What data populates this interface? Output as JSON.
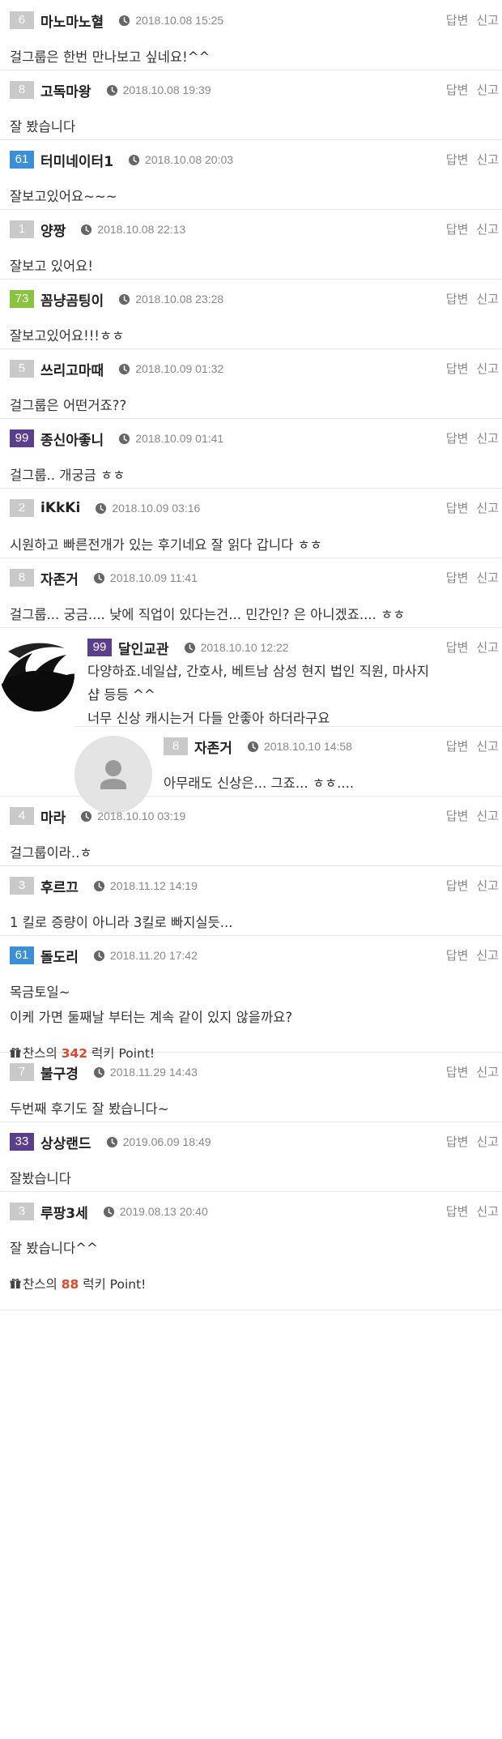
{
  "actions": {
    "reply": "답변",
    "report": "신고"
  },
  "comments": [
    {
      "level": "6",
      "level_color": "#c9c9c9",
      "nick": "마노마노혈",
      "time": "2018.10.08 15:25",
      "lines": [
        "걸그룹은 한번 만나보고 싶네요!^^"
      ]
    },
    {
      "level": "8",
      "level_color": "#c9c9c9",
      "nick": "고독마왕",
      "time": "2018.10.08 19:39",
      "lines": [
        "잘 봤습니다"
      ]
    },
    {
      "level": "61",
      "level_color": "#3a8fd6",
      "nick": "터미네이터1",
      "time": "2018.10.08 20:03",
      "lines": [
        "잘보고있어요~~~"
      ]
    },
    {
      "level": "1",
      "level_color": "#c9c9c9",
      "nick": "양짱",
      "time": "2018.10.08 22:13",
      "lines": [
        "잘보고 있어요!"
      ]
    },
    {
      "level": "73",
      "level_color": "#8ac43f",
      "nick": "꼼냥곰팅이",
      "time": "2018.10.08 23:28",
      "lines": [
        "잘보고있어요!!!ㅎㅎ"
      ]
    },
    {
      "level": "5",
      "level_color": "#c9c9c9",
      "nick": "쓰리고마때",
      "time": "2018.10.09 01:32",
      "lines": [
        "걸그룹은 어떤거죠??"
      ]
    },
    {
      "level": "99",
      "level_color": "#5b3f8c",
      "nick": "종신아좋니",
      "time": "2018.10.09 01:41",
      "lines": [
        "걸그룹.. 개궁금 ㅎㅎ"
      ]
    },
    {
      "level": "2",
      "level_color": "#c9c9c9",
      "nick": "iKkKi",
      "time": "2018.10.09 03:16",
      "lines": [
        "시원하고 빠른전개가 있는 후기네요 잘 읽다 갑니다 ㅎㅎ"
      ]
    },
    {
      "level": "8",
      "level_color": "#c9c9c9",
      "nick": "자존거",
      "time": "2018.10.09 11:41",
      "lines": [
        "걸그룹... 궁금....   낮에 직업이 있다는건...   민간인? 은 아니겠죠....   ㅎㅎ"
      ]
    },
    {
      "level": "99",
      "level_color": "#5b3f8c",
      "nick": "달인교관",
      "time": "2018.10.10 12:22",
      "lines": [
        "다양하죠.네일샵, 간호사, 베트남 삼성 현지 법인 직원, 마사지",
        "샵 등등 ^^",
        "너무 신상 캐시는거 다들 안좋아 하더라구요"
      ]
    },
    {
      "level": "8",
      "level_color": "#c9c9c9",
      "nick": "자존거",
      "time": "2018.10.10 14:58",
      "lines": [
        "아무래도 신상은...   그죠...   ㅎㅎ...."
      ]
    },
    {
      "level": "4",
      "level_color": "#c9c9c9",
      "nick": "마라",
      "time": "2018.10.10 03:19",
      "lines": [
        "걸그룹이라..ㅎ"
      ]
    },
    {
      "level": "3",
      "level_color": "#c9c9c9",
      "nick": "후르끄",
      "time": "2018.11.12 14:19",
      "lines": [
        "1 킬로 증량이 아니라 3킬로 빠지실듯..."
      ]
    },
    {
      "level": "61",
      "level_color": "#3a8fd6",
      "nick": "돌도리",
      "time": "2018.11.20 17:42",
      "lines": [
        "목금토일~",
        "이케 가면 둘째날 부터는 계속 같이 있지 않을까요?"
      ],
      "lucky": {
        "prefix": "찬스의 ",
        "num": "342",
        "suffix": " 럭키 Point!"
      }
    },
    {
      "level": "7",
      "level_color": "#c9c9c9",
      "nick": "불구경",
      "time": "2018.11.29 14:43",
      "lines": [
        "두번째 후기도 잘 봤습니다~"
      ]
    },
    {
      "level": "33",
      "level_color": "#5b3f8c",
      "nick": "상상랜드",
      "time": "2019.06.09 18:49",
      "lines": [
        "잘봤습니다"
      ]
    },
    {
      "level": "3",
      "level_color": "#c9c9c9",
      "nick": "루팡3세",
      "time": "2019.08.13 20:40",
      "lines": [
        "잘 봤습니다^^"
      ],
      "lucky": {
        "prefix": "찬스의 ",
        "num": "88",
        "suffix": " 럭키 Point!"
      }
    }
  ]
}
